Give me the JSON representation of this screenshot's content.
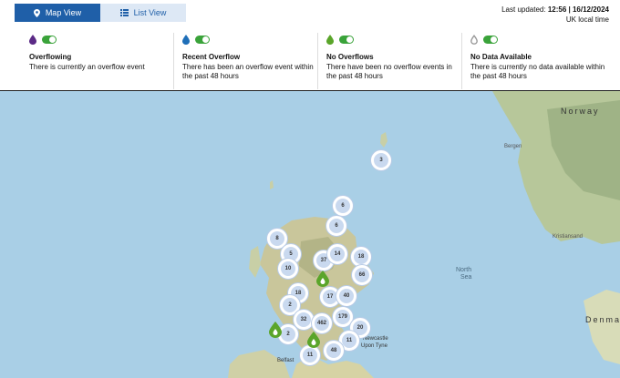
{
  "tabs": [
    {
      "label": "Map View",
      "active": true
    },
    {
      "label": "List View",
      "active": false
    }
  ],
  "updated": {
    "prefix": "Last updated: ",
    "value": "12:56 | 16/12/2024",
    "zone": "UK local time"
  },
  "legend": [
    {
      "title": "Overflowing",
      "desc": "There is currently an overflow event",
      "color": "#5b2a86"
    },
    {
      "title": "Recent Overflow",
      "desc": "There has been an overflow event within the past 48 hours",
      "color": "#1f6fb8"
    },
    {
      "title": "No Overflows",
      "desc": "There have been no overflow events in the past 48 hours",
      "color": "#5aa52a"
    },
    {
      "title": "No Data Available",
      "desc": "There is currently no data available within the past 48 hours",
      "color": "#999999"
    }
  ],
  "map": {
    "labels": {
      "norway": "Norway",
      "bergen": "Bergen",
      "kristiansand": "Kristiansand",
      "north_sea_1": "North",
      "north_sea_2": "Sea",
      "denmark": "Denmar",
      "newcastle_1": "Newcastle",
      "newcastle_2": "Upon Tyne",
      "belfast": "Belfast"
    },
    "clusters": [
      "3",
      "6",
      "6",
      "8",
      "5",
      "37",
      "14",
      "18",
      "10",
      "66",
      "18",
      "17",
      "40",
      "2",
      "32",
      "462",
      "179",
      "20",
      "2",
      "11",
      "11",
      "48"
    ]
  }
}
